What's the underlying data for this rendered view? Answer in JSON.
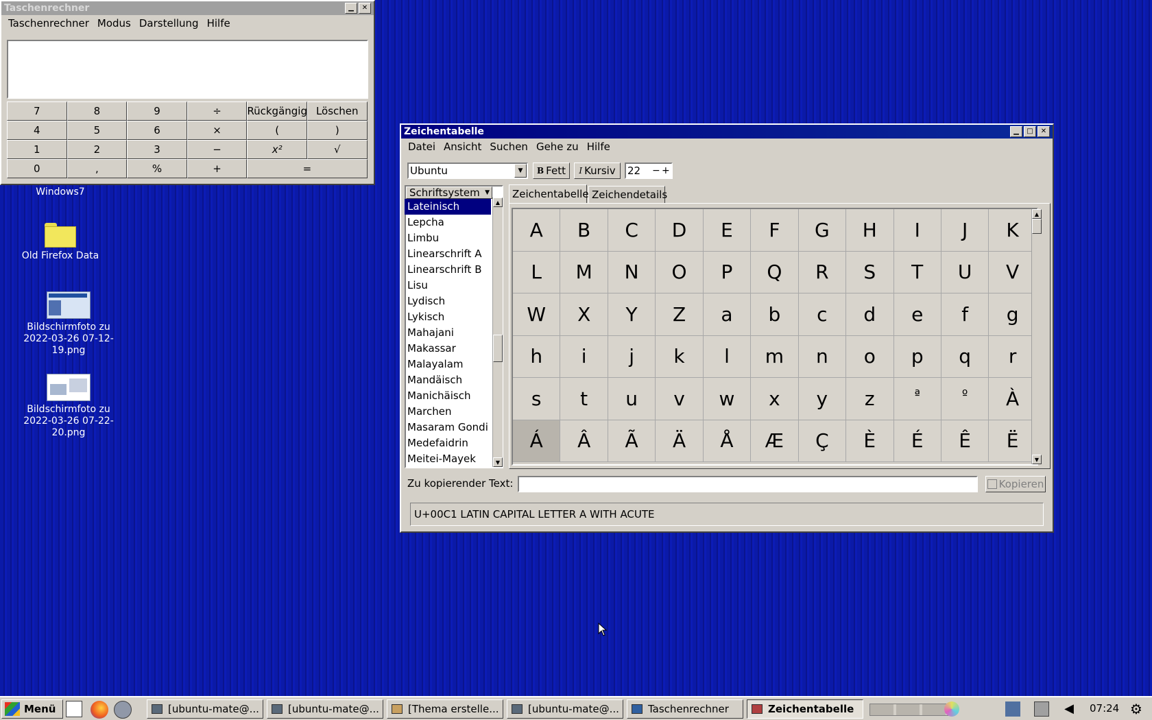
{
  "calculator": {
    "title": "Taschenrechner",
    "menu": [
      "Taschenrechner",
      "Modus",
      "Darstellung",
      "Hilfe"
    ],
    "display": "",
    "buttons": [
      "7",
      "8",
      "9",
      "÷",
      "Rückgängig",
      "Löschen",
      "4",
      "5",
      "6",
      "×",
      "(",
      ")",
      "1",
      "2",
      "3",
      "−",
      "x²",
      "√",
      "0",
      ",",
      "%",
      "+",
      "="
    ]
  },
  "desktop": {
    "icons": [
      {
        "label": "Windows7",
        "icon": "folder-icon"
      },
      {
        "label": "Old Firefox Data",
        "icon": "folder-icon"
      },
      {
        "label": "Bildschirmfoto zu 2022-03-26 07-12-19.png",
        "icon": "image-thumbnail-icon"
      },
      {
        "label": "Bildschirmfoto zu 2022-03-26 07-22-20.png",
        "icon": "image-thumbnail-icon"
      }
    ]
  },
  "charmap": {
    "title": "Zeichentabelle",
    "menu": [
      "Datei",
      "Ansicht",
      "Suchen",
      "Gehe zu",
      "Hilfe"
    ],
    "font": "Ubuntu",
    "bold_label": "Fett",
    "italic_label": "Kursiv",
    "size": "22",
    "list_header": "Schriftsystem",
    "scripts": [
      "Lateinisch",
      "Lepcha",
      "Limbu",
      "Linearschrift A",
      "Linearschrift B",
      "Lisu",
      "Lydisch",
      "Lykisch",
      "Mahajani",
      "Makassar",
      "Malayalam",
      "Mandäisch",
      "Manichäisch",
      "Marchen",
      "Masaram Gondi",
      "Medefaidrin",
      "Meitei-Mayek"
    ],
    "selected_script": "Lateinisch",
    "tabs": [
      "Zeichentabelle",
      "Zeichendetails"
    ],
    "characters": [
      "A",
      "B",
      "C",
      "D",
      "E",
      "F",
      "G",
      "H",
      "I",
      "J",
      "K",
      "L",
      "M",
      "N",
      "O",
      "P",
      "Q",
      "R",
      "S",
      "T",
      "U",
      "V",
      "W",
      "X",
      "Y",
      "Z",
      "a",
      "b",
      "c",
      "d",
      "e",
      "f",
      "g",
      "h",
      "i",
      "j",
      "k",
      "l",
      "m",
      "n",
      "o",
      "p",
      "q",
      "r",
      "s",
      "t",
      "u",
      "v",
      "w",
      "x",
      "y",
      "z",
      "ª",
      "º",
      "À",
      "Á",
      "Â",
      "Ã",
      "Ä",
      "Å",
      "Æ",
      "Ç",
      "È",
      "É",
      "Ê",
      "Ë"
    ],
    "selected_char": "Á",
    "copy_label": "Zu kopierender Text:",
    "copy_value": "",
    "copy_button": "Kopieren",
    "status": "U+00C1 LATIN CAPITAL LETTER A WITH ACUTE"
  },
  "taskbar": {
    "menu_label": "Menü",
    "tasks": [
      "[ubuntu-mate@...",
      "[ubuntu-mate@...",
      "[Thema erstelle...",
      "[ubuntu-mate@...",
      "Taschenrechner",
      "Zeichentabelle"
    ],
    "active_task": "Zeichentabelle",
    "clock": "07:24"
  }
}
